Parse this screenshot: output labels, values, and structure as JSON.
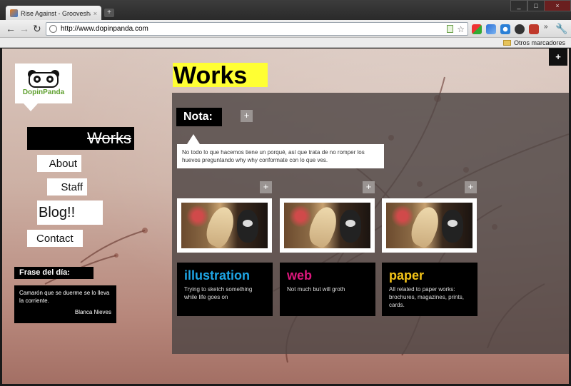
{
  "browser": {
    "tab_title": "Rise Against - Grooveshark",
    "tab_close": "×",
    "new_tab": "+",
    "url": "http://www.dopinpanda.com",
    "window_controls": [
      "_",
      "□",
      "×"
    ],
    "bookmarks_folder": "Otros marcadores",
    "icons": [
      "back-arrow-icon",
      "forward-arrow-icon",
      "reload-icon",
      "globe-icon",
      "page-icon",
      "star-icon",
      "wrench-icon",
      "chevron-icon"
    ]
  },
  "site": {
    "logo_text": "DopinPanda",
    "corner_button": "+",
    "nav": {
      "works": "Works",
      "about": "About",
      "staff": "Staff",
      "blog": "Blog!!",
      "contact": "Contact"
    },
    "frase": {
      "title": "Frase del día:",
      "quote": "Camarón que se duerme se lo lleva la corriente.",
      "author": "Blanca Nieves"
    },
    "page_title": "Works",
    "nota": {
      "label": "Nota:",
      "add": "+",
      "text": "No todo lo que hacemos tiene un porqué, así que trata de no romper los huevos preguntando why why conformate con lo que ves."
    },
    "categories": [
      {
        "title": "illustration",
        "color": "#1ea6e6",
        "desc": "Trying to sketch something while life goes on",
        "add": "+"
      },
      {
        "title": "web",
        "color": "#e0177e",
        "desc": "Not much but will groth",
        "add": "+"
      },
      {
        "title": "paper",
        "color": "#f5c518",
        "desc": "All related to paper works: brochures, magazines, prints, cards.",
        "add": "+"
      }
    ],
    "colors": {
      "highlight": "#ffff33",
      "panel": "#4e4644",
      "logo_green": "#5fa02f"
    }
  }
}
